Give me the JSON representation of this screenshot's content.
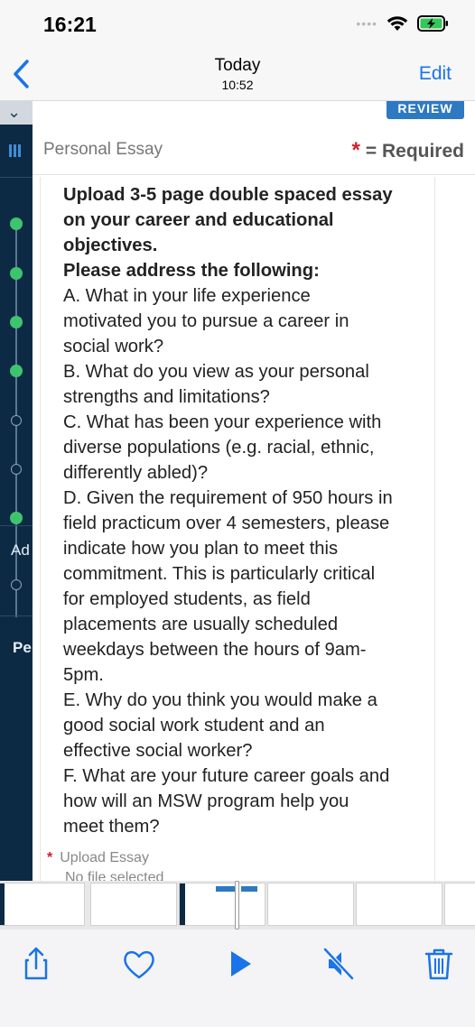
{
  "status_bar": {
    "time": "16:21",
    "signal": "••••"
  },
  "nav": {
    "title": "Today",
    "subtitle": "10:52",
    "edit_label": "Edit"
  },
  "page": {
    "review_label": "REVIEW",
    "section_title": "Personal Essay",
    "required_star": "*",
    "required_label": "= Required",
    "left_rail": {
      "text_1": "Ad",
      "text_2": "Pe"
    },
    "instructions": {
      "heading_1": "Upload 3-5 page double spaced essay",
      "heading_2": "on your career and educational",
      "heading_3": "objectives.",
      "heading_4": "Please address the following:",
      "lines": [
        "A. What in your life experience",
        "motivated you to pursue a career in",
        "social work?",
        "B. What do you view as your personal",
        "strengths and limitations?",
        "C. What has been your experience with",
        "diverse populations (e.g. racial, ethnic,",
        "differently abled)?",
        "D. Given the requirement of 950 hours in",
        "field practicum over 4 semesters, please",
        "indicate how you plan to meet this",
        "commitment. This is particularly critical",
        "for employed students, as field",
        "placements are usually scheduled",
        "weekdays between the hours of 9am-",
        "5pm.",
        "E. Why do you think you would make a",
        "good social work student and an",
        "effective social worker?",
        "F. What are your future career goals and",
        "how will an MSW program help you",
        "meet them?"
      ]
    },
    "upload": {
      "star": "*",
      "label": "Upload Essay",
      "status": "No file selected"
    }
  },
  "toolbar": {
    "share": "share-icon",
    "like": "heart-icon",
    "play": "play-icon",
    "mute": "speaker-muted-icon",
    "delete": "trash-icon"
  },
  "colors": {
    "accent": "#1a73e8",
    "rail": "#0d2a45",
    "complete": "#3fc46e",
    "required": "#d0202a",
    "button": "#2e79c2"
  }
}
